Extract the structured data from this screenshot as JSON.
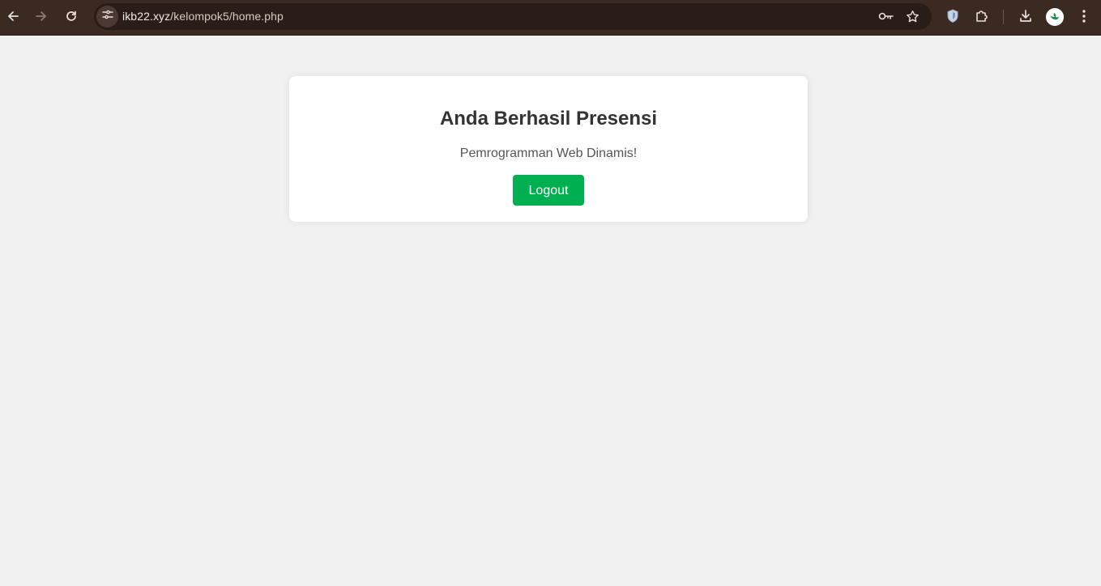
{
  "browser": {
    "url_host": "ikb22.xyz",
    "url_path": "/kelompok5/home.php",
    "icons": {
      "back": "back-arrow-icon",
      "forward": "forward-arrow-icon",
      "reload": "reload-icon",
      "site_info": "tune-icon",
      "password": "key-icon",
      "bookmark": "star-icon",
      "extension_shield": "shield-icon",
      "extensions": "puzzle-icon",
      "downloads": "download-icon",
      "menu": "kebab-menu-icon"
    },
    "toolbar_color": "#3b2a22"
  },
  "page": {
    "heading": "Anda Berhasil Presensi",
    "subtitle": "Pemrogramman Web Dinamis!",
    "logout_label": "Logout",
    "accent_color": "#00b050",
    "background_color": "#f1f1f1"
  }
}
